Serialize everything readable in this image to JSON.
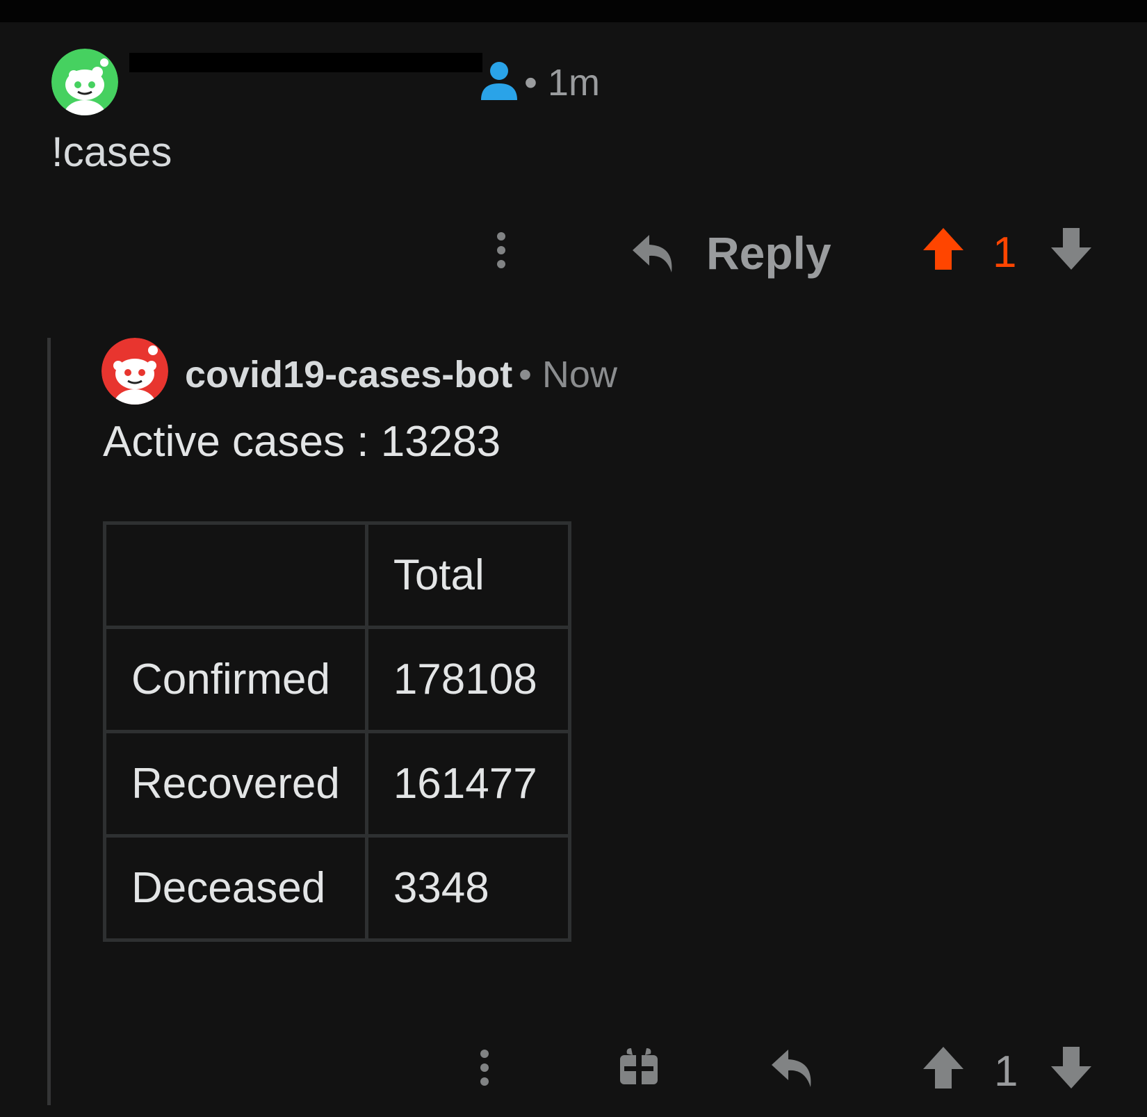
{
  "parent_comment": {
    "time": "• 1m",
    "body": "!cases",
    "actions": {
      "reply_label": "Reply",
      "vote_count": "1"
    }
  },
  "bot_comment": {
    "username": "covid19-cases-bot",
    "time": "• Now",
    "body": "Active cases : 13283",
    "table": {
      "headers": [
        "",
        "Total"
      ],
      "rows": [
        [
          "Confirmed",
          "178108"
        ],
        [
          "Recovered",
          "161477"
        ],
        [
          "Deceased",
          "3348"
        ]
      ]
    },
    "actions": {
      "vote_count": "1"
    }
  },
  "colors": {
    "background": "#121212",
    "upvote_active": "#ff4500",
    "op_icon": "#0dd3bb",
    "muted_icon": "#818384",
    "thread_line": "#343536"
  },
  "icons": [
    "snoo-avatar-green",
    "op-user-icon",
    "more-icon",
    "reply-icon",
    "upvote-icon",
    "downvote-icon",
    "snoo-avatar-red",
    "gift-icon"
  ]
}
